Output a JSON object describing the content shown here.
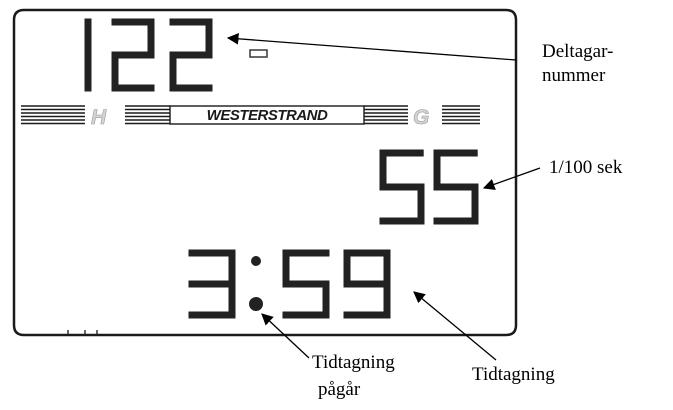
{
  "display": {
    "competitor_number": "122",
    "hundredths": "55",
    "running_time": "3:59",
    "brand": "WESTERSTRAND",
    "left_letter": "H",
    "right_letter": "G",
    "colors": {
      "segment": "#222222",
      "letter_fill": "#d4d4d4",
      "frame": "#1a1a1a"
    }
  },
  "callouts": {
    "competitor_number": [
      "Deltagar-",
      "nummer"
    ],
    "hundredths": "1/100 sek",
    "timing_running": [
      "Tidtagning",
      "pågår"
    ],
    "timing": "Tidtagning"
  }
}
